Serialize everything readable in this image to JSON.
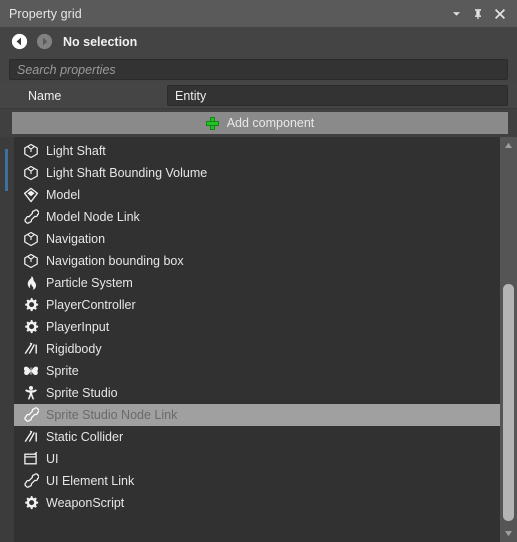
{
  "window": {
    "title": "Property grid",
    "controls": [
      {
        "name": "dropdown-icon",
        "label": "Window menu"
      },
      {
        "name": "pin-icon",
        "label": "Auto hide"
      },
      {
        "name": "close-icon",
        "label": "Close"
      }
    ]
  },
  "nav": {
    "back_label": "Back",
    "forward_label": "Forward",
    "selection_text": "No selection"
  },
  "search": {
    "placeholder": "Search properties",
    "value": ""
  },
  "name_row": {
    "label": "Name",
    "value": "Entity"
  },
  "add_component": {
    "label": "Add component",
    "icon": "plus-icon",
    "accent_color": "#25c025"
  },
  "components": {
    "selected_index": 12,
    "items": [
      {
        "label": "Light Shaft",
        "icon": "cube-icon"
      },
      {
        "label": "Light Shaft Bounding Volume",
        "icon": "cube-icon"
      },
      {
        "label": "Model",
        "icon": "model-icon"
      },
      {
        "label": "Model Node Link",
        "icon": "bone-icon"
      },
      {
        "label": "Navigation",
        "icon": "cube-icon"
      },
      {
        "label": "Navigation bounding box",
        "icon": "cube-icon"
      },
      {
        "label": "Particle System",
        "icon": "flame-icon"
      },
      {
        "label": "PlayerController",
        "icon": "gear-icon"
      },
      {
        "label": "PlayerInput",
        "icon": "gear-icon"
      },
      {
        "label": "Rigidbody",
        "icon": "rigidbody-icon"
      },
      {
        "label": "Sprite",
        "icon": "butterfly-icon"
      },
      {
        "label": "Sprite Studio",
        "icon": "figure-icon"
      },
      {
        "label": "Sprite Studio Node Link",
        "icon": "bone-icon"
      },
      {
        "label": "Static Collider",
        "icon": "rigidbody-icon"
      },
      {
        "label": "UI",
        "icon": "window-icon"
      },
      {
        "label": "UI Element Link",
        "icon": "bone-icon"
      },
      {
        "label": "WeaponScript",
        "icon": "gear-icon"
      }
    ]
  },
  "scrollbar": {
    "up_label": "Scroll up",
    "down_label": "Scroll down",
    "thumb_label": "Scroll thumb"
  },
  "theme": {
    "panel_bg": "#404040",
    "titlebar_bg": "#5a5a5a",
    "list_bg": "#313131",
    "selection_bg": "#a0a0a0",
    "accent_blue": "#3f6f9f",
    "add_button_bg": "#8a8a8a"
  }
}
